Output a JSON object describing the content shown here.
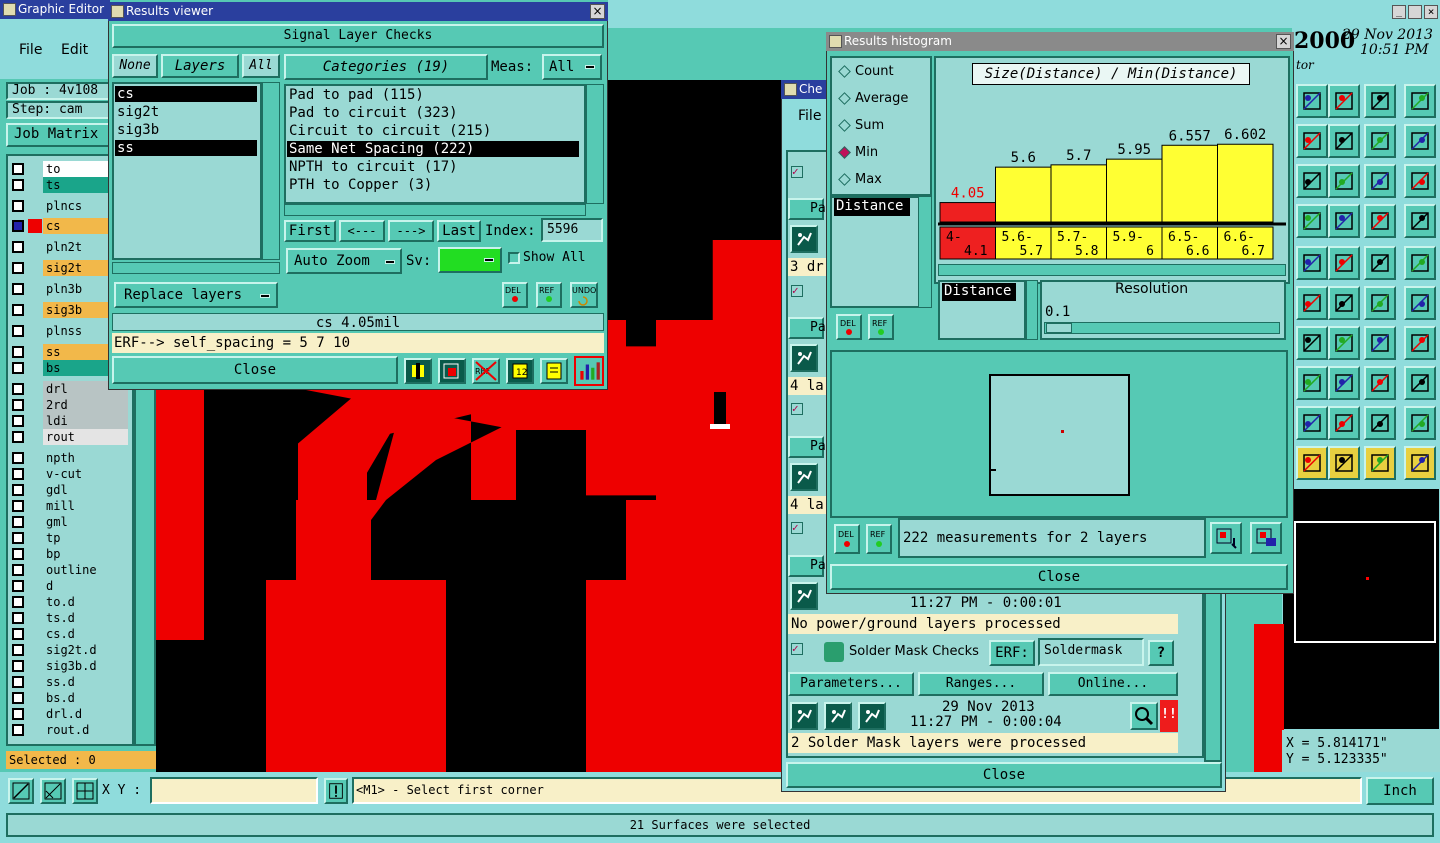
{
  "graphic_editor": {
    "title": "Graphic Editor",
    "menu": [
      "File",
      "Edit"
    ],
    "job_label": "Job : 4v108",
    "step_label": "Step: cam",
    "job_matrix": "Job Matrix",
    "layers": [
      {
        "name": "to",
        "color": "#ffffff"
      },
      {
        "name": "ts",
        "color": "#1aa58a"
      },
      {
        "name": "plncs",
        "color": "#9ad9d4"
      },
      {
        "name": "cs",
        "color": "#f2b84a",
        "active": true
      },
      {
        "name": "pln2t",
        "color": "#9ad9d4"
      },
      {
        "name": "sig2t",
        "color": "#f2b84a"
      },
      {
        "name": "pln3b",
        "color": "#9ad9d4"
      },
      {
        "name": "sig3b",
        "color": "#f2b84a"
      },
      {
        "name": "plnss",
        "color": "#9ad9d4"
      },
      {
        "name": "ss",
        "color": "#f2b84a"
      },
      {
        "name": "bs",
        "color": "#1aa58a"
      },
      {
        "name": "drl",
        "color": "#b8c4c4"
      },
      {
        "name": "2rd",
        "color": "#b8c4c4"
      },
      {
        "name": "ldi",
        "color": "#b8c4c4"
      },
      {
        "name": "rout",
        "color": "#e4e4e4"
      },
      {
        "name": "npth",
        "color": "#9ad9d4"
      },
      {
        "name": "v-cut",
        "color": "#9ad9d4"
      },
      {
        "name": "gdl",
        "color": "#9ad9d4"
      },
      {
        "name": "mill",
        "color": "#9ad9d4"
      },
      {
        "name": "gml",
        "color": "#9ad9d4"
      },
      {
        "name": "tp",
        "color": "#9ad9d4"
      },
      {
        "name": "bp",
        "color": "#9ad9d4"
      },
      {
        "name": "outline",
        "color": "#9ad9d4"
      },
      {
        "name": "d",
        "color": "#9ad9d4"
      },
      {
        "name": "to.d",
        "color": "#9ad9d4"
      },
      {
        "name": "ts.d",
        "color": "#9ad9d4"
      },
      {
        "name": "cs.d",
        "color": "#9ad9d4"
      },
      {
        "name": "sig2t.d",
        "color": "#9ad9d4"
      },
      {
        "name": "sig3b.d",
        "color": "#9ad9d4"
      },
      {
        "name": "ss.d",
        "color": "#9ad9d4"
      },
      {
        "name": "bs.d",
        "color": "#9ad9d4"
      },
      {
        "name": "drl.d",
        "color": "#9ad9d4"
      },
      {
        "name": "rout.d",
        "color": "#9ad9d4"
      }
    ],
    "selected": "Selected : 0",
    "xy_label": "X Y :",
    "xy_value": "",
    "prompt": "<M1> - Select first corner",
    "units": "Inch",
    "status": "21 Surfaces were selected",
    "coord_x": "X  = 5.814171\"",
    "coord_y": "Y  = 5.123335\"",
    "clock_year_partial": "2000",
    "clock_date": "29 Nov 2013",
    "clock_time": "10:51 PM",
    "clock_sub": "tor"
  },
  "results_viewer": {
    "title": "Results viewer",
    "header": "Signal Layer Checks",
    "none": "None",
    "layers_label": "Layers",
    "all": "All",
    "layer_list": [
      "cs",
      "sig2t",
      "sig3b",
      "ss"
    ],
    "categories_label": "Categories (19)",
    "meas_label": "Meas:",
    "meas_value": "All",
    "categories": [
      "Pad to pad (115)",
      "Pad to circuit (323)",
      "Circuit to circuit (215)",
      "Same Net Spacing (222)",
      "NPTH to circuit (17)",
      "PTH to Copper (3)"
    ],
    "selected_category": 3,
    "first": "First",
    "prev": "<---",
    "next": "--->",
    "last": "Last",
    "index_label": "Index:",
    "index_value": "5596",
    "replace_layers": "Replace layers",
    "auto_zoom": "Auto Zoom",
    "sv_label": "Sv:",
    "show_all": "Show All",
    "del": "DEL",
    "ref": "REF",
    "undo": "UNDO",
    "status_value": "cs 4.05mil",
    "erf_line": "ERF--> self_spacing = 5 7 10",
    "close": "Close"
  },
  "histogram": {
    "title": "Results histogram",
    "options": [
      "Count",
      "Average",
      "Sum",
      "Min",
      "Max"
    ],
    "selected_option": 3,
    "chart_title": "Size(Distance) / Min(Distance)",
    "list_item": "Distance",
    "resolution_label": "Resolution",
    "resolution_value": "0.1",
    "axis_label": "Distance",
    "measurements": "222 measurements for 2 layers",
    "close": "Close",
    "del": "DEL",
    "ref": "REF"
  },
  "chart_data": {
    "type": "bar",
    "title": "Size(Distance) / Min(Distance)",
    "categories": [
      "4-4.1",
      "5.6-5.7",
      "5.7-5.8",
      "5.9-6",
      "6.5-6.6",
      "6.6-6.7"
    ],
    "values": [
      4.05,
      5.6,
      5.7,
      5.95,
      6.557,
      6.602
    ],
    "value_labels": [
      "4.05",
      "5.6",
      "5.7",
      "5.95",
      "6.557",
      "6.602"
    ],
    "category_labels_top": [
      "4-",
      "5.6-",
      "5.7-",
      "5.9-",
      "6.5-",
      "6.6-"
    ],
    "category_labels_bottom": [
      "4.1",
      "5.7",
      "5.8",
      "6",
      "6.6",
      "6.7"
    ],
    "colors": [
      "#ee2020",
      "#ffff33",
      "#ffff33",
      "#ffff33",
      "#ffff33",
      "#ffff33"
    ],
    "ylim": [
      0,
      7.5
    ]
  },
  "checks": {
    "title_partial": "Che",
    "file_label": "File",
    "rows": [
      "Pa",
      "3 dr",
      "Pa",
      "4 la",
      "Pa",
      "4 la",
      "Pa"
    ],
    "time_line": "11:27 PM - 0:00:01",
    "power_msg": "No power/ground layers processed",
    "solder_title": "Solder Mask Checks",
    "erf_label": "ERF:",
    "erf_value": "Soldermask",
    "parameters": "Parameters...",
    "ranges": "Ranges...",
    "online": "Online...",
    "date2": "29 Nov 2013",
    "time2": "11:27 PM - 0:00:04",
    "solder_msg": "2 Solder Mask layers were processed",
    "close": "Close",
    "help": "?"
  }
}
